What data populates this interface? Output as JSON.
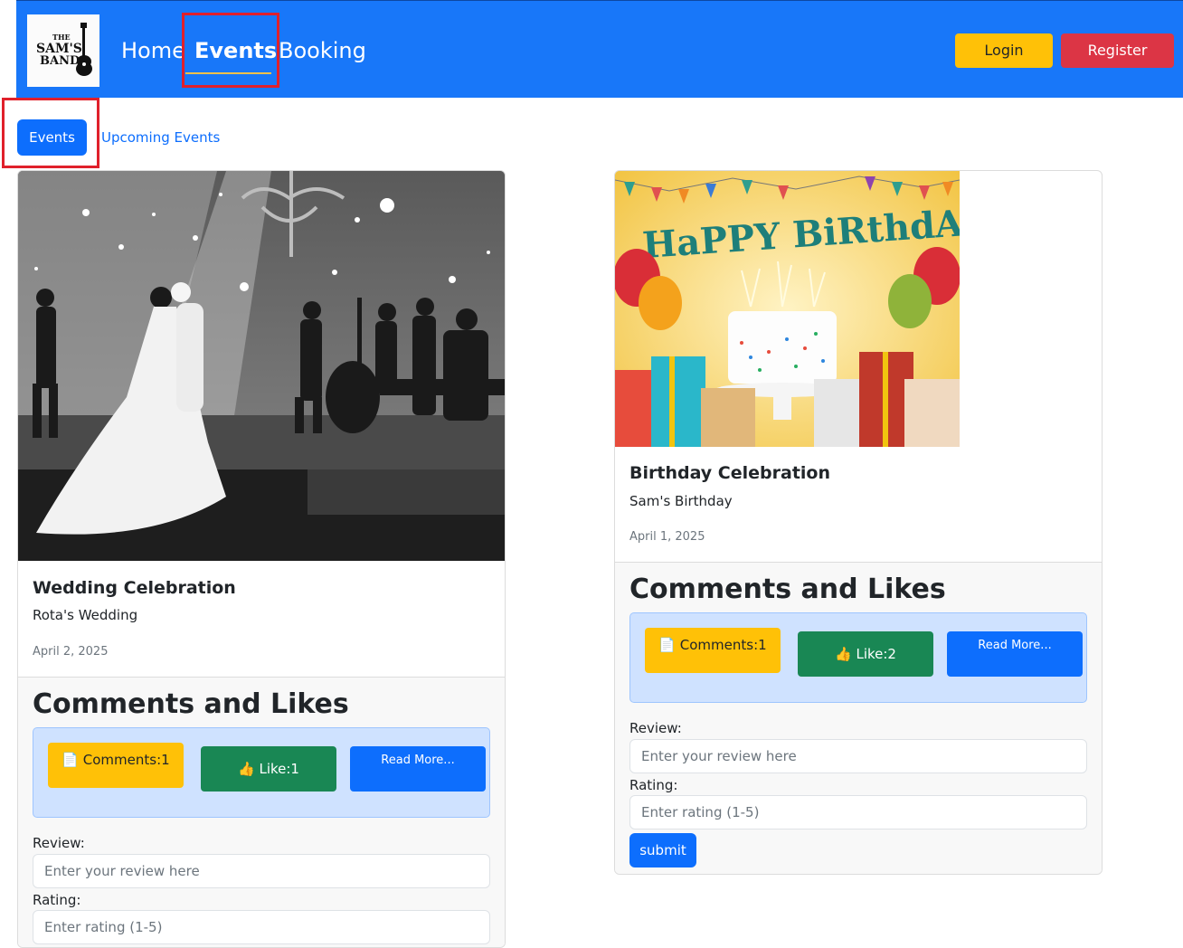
{
  "navbar": {
    "logo": {
      "top": "THE",
      "middle": "SAM'S",
      "bottom": "BAND"
    },
    "links": {
      "home": "Home",
      "events": "Events",
      "booking": "Booking"
    },
    "login": "Login",
    "register": "Register"
  },
  "subnav": {
    "events": "Events",
    "upcoming": "Upcoming Events"
  },
  "icons": {
    "comments": "document-icon",
    "like": "thumbs-up-icon"
  },
  "colors": {
    "primary": "#0d6efd",
    "navbar": "#1877f9",
    "warning": "#ffc107",
    "danger": "#dc3545",
    "success": "#198754"
  },
  "cards": [
    {
      "image_text": "",
      "title": "Wedding Celebration",
      "subtitle": "Rota's Wedding",
      "date": "April 2, 2025",
      "footer_heading": "Comments and Likes",
      "comments_label": "Comments:1",
      "like_label": "Like:1",
      "read_more": "Read More...",
      "review_label": "Review:",
      "review_placeholder": "Enter your review here",
      "rating_label": "Rating:",
      "rating_placeholder": "Enter rating (1-5)"
    },
    {
      "image_text": "HaPPY BiRthdAY!",
      "title": "Birthday Celebration",
      "subtitle": "Sam's Birthday",
      "date": "April 1, 2025",
      "footer_heading": "Comments and Likes",
      "comments_label": "Comments:1",
      "like_label": "Like:2",
      "read_more": "Read More...",
      "review_label": "Review:",
      "review_placeholder": "Enter your review here",
      "rating_label": "Rating:",
      "rating_placeholder": "Enter rating (1-5)",
      "submit": "submit"
    }
  ]
}
